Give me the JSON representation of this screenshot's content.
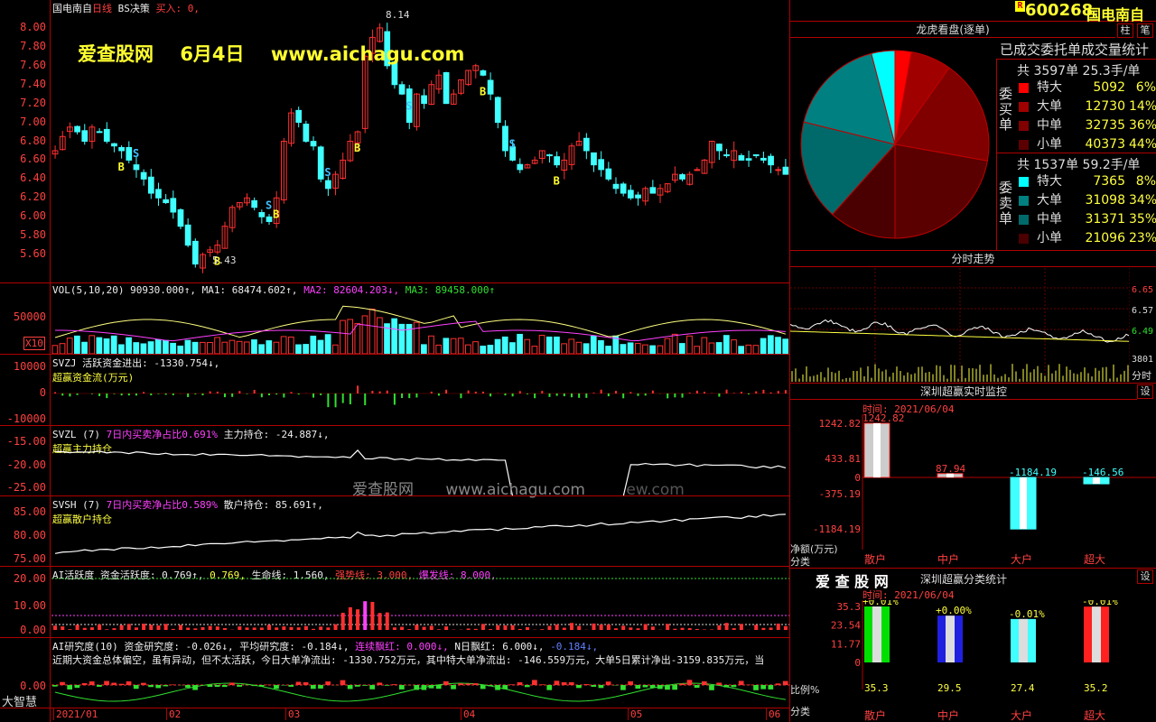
{
  "title_bar": {
    "name_label": "国电南自",
    "period_label": "日线",
    "indicator_label": "BS决策",
    "buy_label": "买入: 0,"
  },
  "watermark": {
    "brand": "爱查股网",
    "date": "6月4日",
    "url": "www.aichagu.com",
    "faint_brand": "爱查股网",
    "faint_url": "www.aichagu.com",
    "faint_tail": "ew.com"
  },
  "price_panel": {
    "y_ticks": [
      "8.00",
      "7.80",
      "7.60",
      "7.40",
      "7.20",
      "7.00",
      "6.80",
      "6.60",
      "6.40",
      "6.20",
      "6.00",
      "5.80",
      "5.60"
    ],
    "high_label": "8.14",
    "low_label": "5.43",
    "signal_b": "B",
    "signal_s": "S"
  },
  "chart_data": [
    {
      "type": "candlestick",
      "name": "国电南自 日线",
      "ylim": [
        5.4,
        8.2
      ],
      "close": [
        6.7,
        6.85,
        6.95,
        6.9,
        6.8,
        6.95,
        6.9,
        6.8,
        6.75,
        6.7,
        6.6,
        6.5,
        6.4,
        6.25,
        6.2,
        6.15,
        6.05,
        5.9,
        5.7,
        5.5,
        5.6,
        5.65,
        5.7,
        5.9,
        6.1,
        6.15,
        6.2,
        6.1,
        6.0,
        5.95,
        6.2,
        6.8,
        7.1,
        7.0,
        6.8,
        6.75,
        6.4,
        6.3,
        6.45,
        6.6,
        6.8,
        6.9,
        7.7,
        7.9,
        8.0,
        7.6,
        7.4,
        7.3,
        7.0,
        7.3,
        7.2,
        7.4,
        7.5,
        7.2,
        7.3,
        7.45,
        7.55,
        7.6,
        7.5,
        7.3,
        7.0,
        6.7,
        6.6,
        6.5,
        6.55,
        6.6,
        6.7,
        6.65,
        6.55,
        6.6,
        6.75,
        6.8,
        6.7,
        6.55,
        6.5,
        6.4,
        6.3,
        6.25,
        6.2,
        6.2,
        6.3,
        6.25,
        6.3,
        6.35,
        6.45,
        6.4,
        6.45,
        6.5,
        6.6,
        6.8,
        6.7,
        6.65,
        6.7,
        6.6,
        6.6,
        6.65,
        6.6,
        6.55,
        6.5,
        6.45
      ]
    },
    {
      "type": "bar",
      "name": "VOL(5,10,20)",
      "values": [
        90930,
        68474.602,
        82604.203,
        89458
      ],
      "series": [
        "VOL",
        "MA1",
        "MA2",
        "MA3"
      ],
      "y_tick": "50000",
      "unit_badge": "X10"
    },
    {
      "type": "bar",
      "name": "SVZJ",
      "value": -1330.754,
      "y_ticks": [
        "10000",
        "0",
        "-10000"
      ]
    },
    {
      "type": "line",
      "name": "SVZL(7)",
      "value": -24.887,
      "y_ticks": [
        "-15.00",
        "-20.00",
        "-25.00"
      ]
    },
    {
      "type": "line",
      "name": "SVSH(7)",
      "value": 85.691,
      "y_ticks": [
        "85.00",
        "80.00",
        "75.00"
      ]
    },
    {
      "type": "bar",
      "name": "AI活跃度",
      "y_ticks": [
        "20.00",
        "10.00",
        "0.00"
      ]
    },
    {
      "type": "bar",
      "name": "AI研究度(10)",
      "y_ticks": [
        "0.00"
      ]
    }
  ],
  "vol_title": {
    "name": "VOL(5,10,20)",
    "vol": "90930.000↑,",
    "ma1": "MA1: 68474.602↑,",
    "ma2": "MA2: 82604.203↓,",
    "ma3": "MA3: 89458.000↑"
  },
  "svzj_title": {
    "name": "SVZJ",
    "text": "活跃资金进出: -1330.754↓,",
    "sub": "超赢资金流(万元)"
  },
  "svzl_title": {
    "name": "SVZL (7)",
    "pct": "7日内买卖净占比0.691%",
    "text": "主力持仓: -24.887↓,",
    "sub": "超赢主力持仓"
  },
  "svsh_title": {
    "name": "SVSH (7)",
    "pct": "7日内买卖净占比0.589%",
    "text": "散户持仓: 85.691↑,",
    "sub": "超赢散户持仓"
  },
  "ai_title": {
    "name": "AI活跃度",
    "t1": "资金活跃度: 0.769↑,",
    "t2": "0.769,",
    "t3": "生命线: 1.560,",
    "t4": "强势线: 3.000,",
    "t5": "爆发线: 8.000,"
  },
  "ai2_title": {
    "name": "AI研究度(10)",
    "t1": "资金研究度: -0.026↓,",
    "t2": "平均研究度: -0.184↓,",
    "t3": "连续飘红: 0.000↓,",
    "t4": "N日飘红: 6.000↓,",
    "t5": "-0.184↓,"
  },
  "ai2_comment": "近期大资金总体偏空，虽有异动，但不太活跃，今日大单净流出: -1330.752万元，其中特大单净流出: -146.559万元，大单5日累计净出-3159.835万元，当",
  "time_axis": {
    "labels": [
      "2021/01",
      "02",
      "03",
      "04",
      "05",
      "06"
    ]
  },
  "left_logo": "大智慧",
  "stock_header": {
    "badge": "R",
    "code": "600268",
    "name": "国电南自",
    "btn1": "柱",
    "btn2": "笔"
  },
  "dragon": {
    "title": "龙虎看盘(逐单)",
    "subtitle": "已成交委托单成交量统计",
    "buy": {
      "side": "委买单",
      "total_count": "共 3597单",
      "avg": "25.3手/单",
      "rows": [
        {
          "label": "特大",
          "count": "5092",
          "pct": "6%",
          "color": "#ff0000"
        },
        {
          "label": "大单",
          "count": "12730",
          "pct": "14%",
          "color": "#a00000"
        },
        {
          "label": "中单",
          "count": "32735",
          "pct": "36%",
          "color": "#800000"
        },
        {
          "label": "小单",
          "count": "40373",
          "pct": "44%",
          "color": "#5a0000"
        }
      ]
    },
    "sell": {
      "side": "委卖单",
      "total_count": "共 1537单",
      "avg": "59.2手/单",
      "rows": [
        {
          "label": "特大",
          "count": "7365",
          "pct": "8%",
          "color": "#00ffff"
        },
        {
          "label": "大单",
          "count": "31098",
          "pct": "34%",
          "color": "#008080"
        },
        {
          "label": "中单",
          "count": "31371",
          "pct": "35%",
          "color": "#006a6a"
        },
        {
          "label": "小单",
          "count": "21096",
          "pct": "23%",
          "color": "#4a0000"
        }
      ]
    }
  },
  "intraday": {
    "title": "分时走势",
    "prices": [
      "6.65",
      "6.57",
      "6.49"
    ],
    "volume": "3801",
    "vol_label": "分时"
  },
  "monitor": {
    "title": "深圳超赢实时监控",
    "btn": "设",
    "time": "时间: 2021/06/04",
    "y_ticks": [
      "1242.82",
      "433.81",
      "0",
      "-375.19",
      "-1184.19"
    ],
    "bars": [
      {
        "label": "散户",
        "value": "1242.82"
      },
      {
        "label": "中户",
        "value": "87.94"
      },
      {
        "label": "大户",
        "value": "-1184.19"
      },
      {
        "label": "超大",
        "value": "-146.56"
      }
    ],
    "ylabel": "净额(万元)",
    "xlabel": "分类"
  },
  "classify": {
    "brand": "爱 查 股 网",
    "title": "深圳超赢分类统计",
    "btn": "设",
    "time": "时间: 2021/06/04",
    "y_ticks": [
      "35.3",
      "23.54",
      "11.77",
      "0"
    ],
    "bars": [
      {
        "label": "散户",
        "value": "35.3",
        "change": "+0.01%"
      },
      {
        "label": "中户",
        "value": "29.5",
        "change": "+0.00%"
      },
      {
        "label": "大户",
        "value": "27.4",
        "change": "-0.01%"
      },
      {
        "label": "超大",
        "value": "35.2",
        "change": "-0.01%"
      }
    ],
    "ylabel": "比例%",
    "xlabel": "分类"
  }
}
